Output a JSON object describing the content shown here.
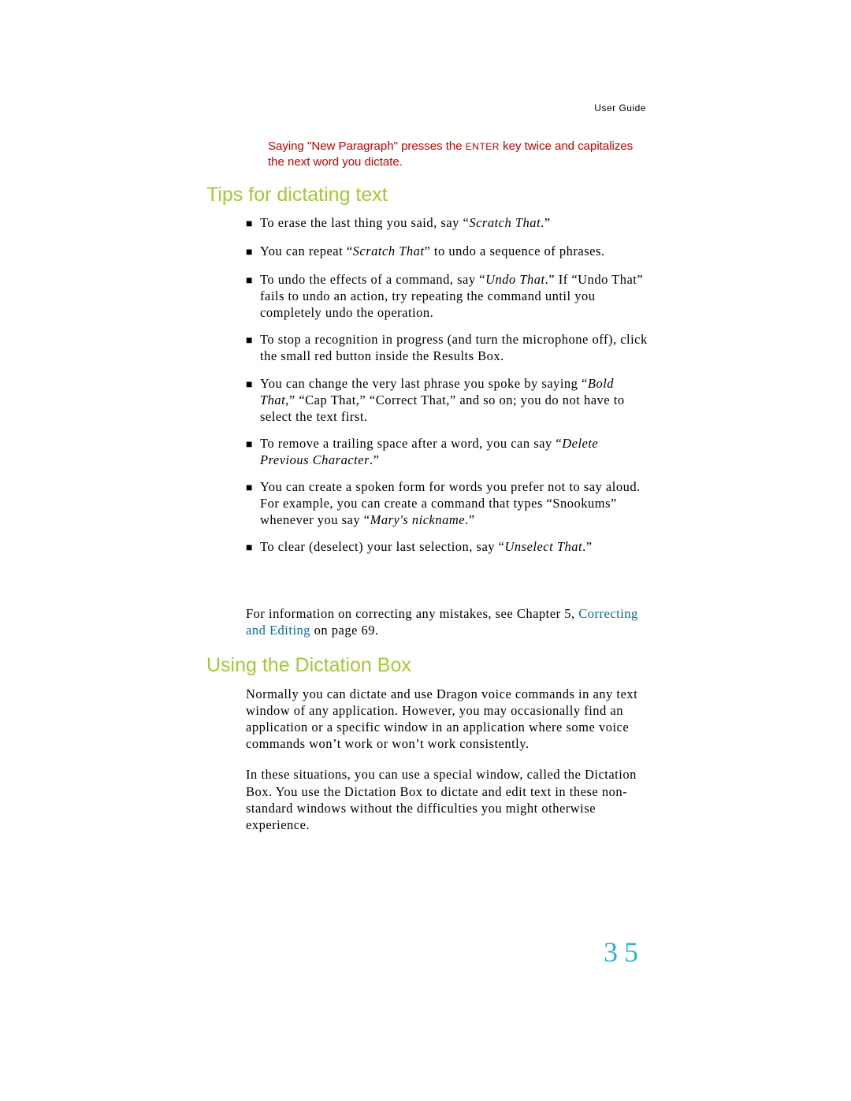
{
  "header": {
    "label": "User Guide"
  },
  "note": {
    "pre": "Saying \"New Paragraph\" presses the ",
    "key": "ENTER",
    "post": " key twice and capitalizes the next word you dictate."
  },
  "headings": {
    "tips": "Tips for dictating text",
    "dictation": "Using the Dictation Box"
  },
  "bullets": [
    {
      "pre": "To erase the last thing you said, say “",
      "em": "Scratch That",
      "post": ".”"
    },
    {
      "pre": "You can repeat “",
      "em": "Scratch That",
      "post": "” to undo a sequence of phrases."
    },
    {
      "pre": "To undo the effects of a command, say “",
      "em": "Undo That",
      "post": ".” If “Undo That” fails to undo an action, try repeating the command until you completely undo the operation."
    },
    {
      "pre": "To stop a recognition in progress (and turn the microphone off), click the small red button inside the Results Box.",
      "em": "",
      "post": ""
    },
    {
      "pre": "You can change the very last phrase you spoke by saying “",
      "em": "Bold That",
      "post": ",” “Cap That,” “Correct That,” and so on; you do not have to select the text first."
    },
    {
      "pre": "To remove a trailing space after a word, you can say “",
      "em": "Delete Previous Character",
      "post": ".”"
    },
    {
      "pre": "You can create a spoken form for words you prefer not to say aloud. For example, you can create a command that types “Snookums” whenever you say “",
      "em": "Mary's nickname",
      "post": ".”"
    },
    {
      "pre": "To clear (deselect) your last selection, say “",
      "em": "Unselect That",
      "post": ".”"
    }
  ],
  "footnote": {
    "pre": "For information on correcting any mistakes, see Chapter 5, ",
    "link": "Correcting and Editing",
    "post": " on page 69."
  },
  "dictation_paras": [
    "Normally you can dictate and use Dragon voice commands in any text window of any application. However, you may occasionally find an application or a specific window in an application where some voice commands won’t work or won’t work consistently.",
    "In these situations, you can use a special window, called the Dictation Box. You use the Dictation Box to dictate and edit text in these non-standard windows without the difficulties you might otherwise experience."
  ],
  "page_number": "35"
}
